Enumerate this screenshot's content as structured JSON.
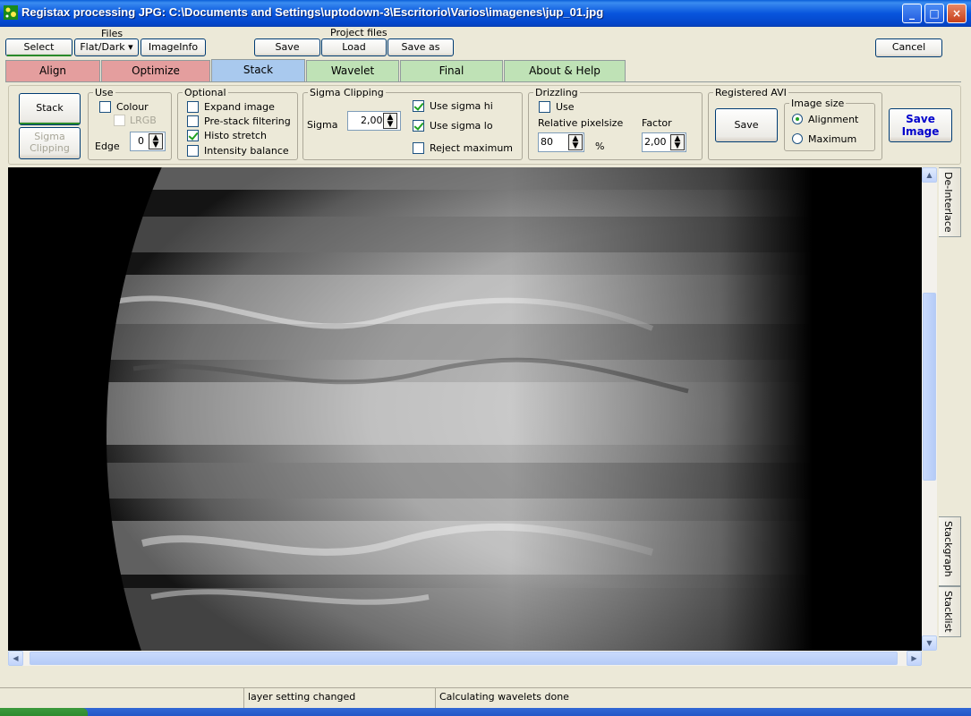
{
  "window": {
    "title": "Registax processing JPG: C:\\Documents and Settings\\uptodown-3\\Escritorio\\Varios\\imagenes\\jup_01.jpg",
    "controls": [
      "_",
      "□",
      "×"
    ]
  },
  "toolbar": {
    "files_label": "Files",
    "select": "Select",
    "flat_dark": "Flat/Dark ▾",
    "imageinfo": "ImageInfo",
    "project_files_label": "Project files",
    "save": "Save",
    "load": "Load",
    "save_as": "Save as",
    "cancel": "Cancel"
  },
  "tabs": [
    {
      "label": "Align",
      "color": "#e09a9a"
    },
    {
      "label": "Optimize",
      "color": "#e09a9a"
    },
    {
      "label": "Stack",
      "color": "#a9c9ee",
      "active": true
    },
    {
      "label": "Wavelet",
      "color": "#b8dfb0"
    },
    {
      "label": "Final",
      "color": "#b8dfb0"
    },
    {
      "label": "About & Help",
      "color": "#b8dfb0"
    }
  ],
  "stack_panel": {
    "stack_button": "Stack",
    "sigma_clipping_button": "Sigma Clipping",
    "use": {
      "title": "Use",
      "colour": "Colour",
      "colour_checked": false,
      "lrgb": "LRGB",
      "edge_label": "Edge",
      "edge_value": "0"
    },
    "optional": {
      "title": "Optional",
      "items": [
        {
          "label": "Expand image",
          "checked": false
        },
        {
          "label": "Pre-stack filtering",
          "checked": false
        },
        {
          "label": "Histo stretch",
          "checked": true
        },
        {
          "label": "Intensity balance",
          "checked": false
        }
      ]
    },
    "sigma_clipping": {
      "title": "Sigma Clipping",
      "sigma_label": "Sigma",
      "sigma_value": "2,00",
      "use_sigma_hi": "Use sigma hi",
      "use_sigma_hi_checked": true,
      "use_sigma_lo": "Use sigma lo",
      "use_sigma_lo_checked": true,
      "reject_maximum": "Reject maximum",
      "reject_maximum_checked": false
    },
    "drizzling": {
      "title": "Drizzling",
      "use": "Use",
      "use_checked": false,
      "relative_pixelsize": "Relative pixelsize",
      "pixelsize_value": "80",
      "percent": "%",
      "factor_label": "Factor",
      "factor_value": "2,00"
    },
    "registered_avi": {
      "title": "Registered AVI",
      "save": "Save",
      "image_size_title": "Image size",
      "alignment": "Alignment",
      "maximum": "Maximum",
      "selected": "Alignment"
    },
    "save_image": "Save Image"
  },
  "side_tabs": {
    "de_interlace": "De-Interlace",
    "stackgraph": "Stackgraph",
    "stacklist": "Stacklist"
  },
  "status": {
    "cell2": "layer setting changed",
    "cell3": "Calculating wavelets done"
  }
}
